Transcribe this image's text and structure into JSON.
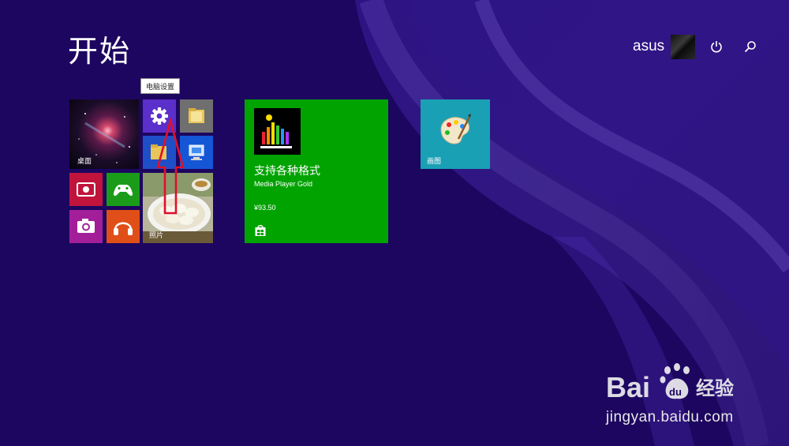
{
  "header": {
    "title": "开始",
    "user_name": "asus"
  },
  "tooltip": {
    "text": "电脑设置"
  },
  "tiles": {
    "desktop": {
      "label": "桌面"
    },
    "photos": {
      "label": "照片"
    },
    "paint": {
      "label": "画图"
    },
    "store_app": {
      "title": "支持各种格式",
      "subtitle": "Media Player Gold",
      "price": "¥93.50"
    }
  },
  "icons": {
    "settings": "gear-icon",
    "power": "power-icon",
    "search": "search-icon"
  },
  "watermark": {
    "url": "jingyan.baidu.com",
    "brand": "Bai du 经验"
  },
  "colors": {
    "background": "#1d0660",
    "settings_tile": "#5b2fc9",
    "video_tile": "#c0143c",
    "games_tile": "#1a9c1a",
    "camera_tile": "#a31f9a",
    "music_tile": "#e14f18",
    "store_tile": "#00a300",
    "paint_tile": "#1aa0b5",
    "annotation_arrow": "#e0102a"
  }
}
